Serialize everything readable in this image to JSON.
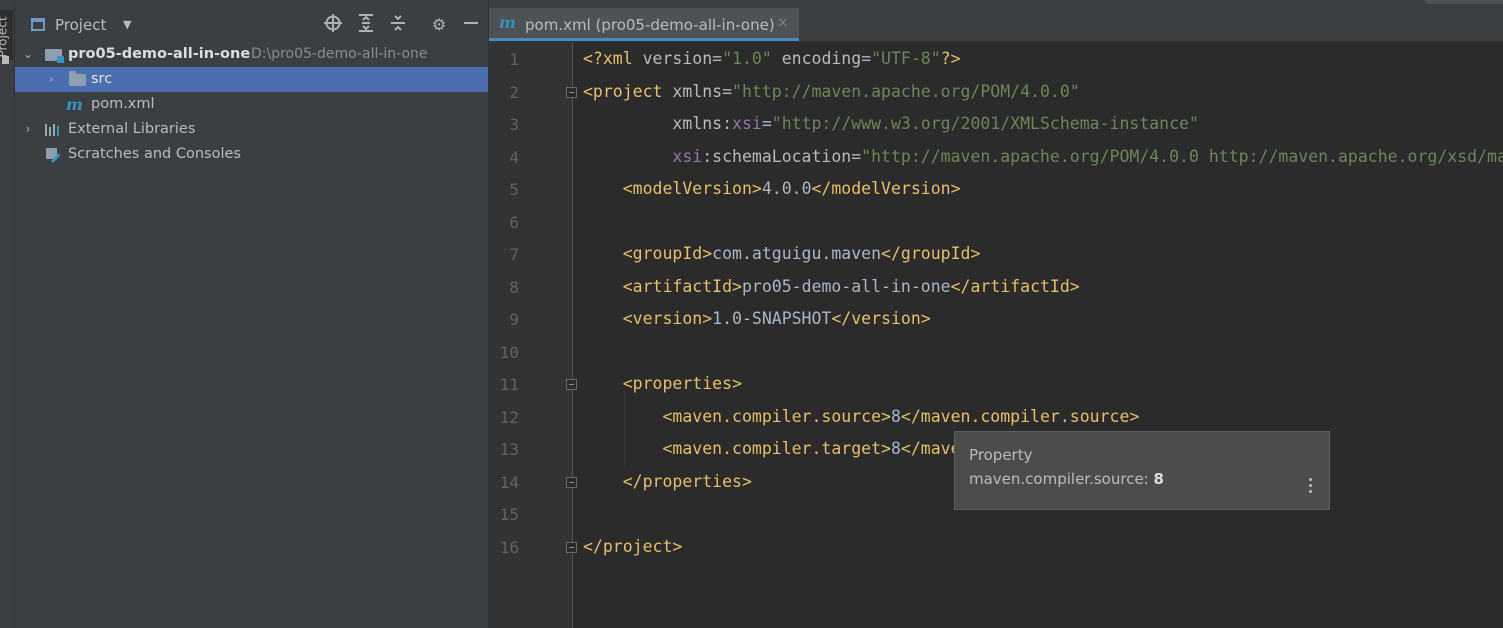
{
  "side_strip": {
    "label": "Project"
  },
  "project_panel": {
    "title": "Project",
    "header_buttons": [
      "locate-icon",
      "expand-all-icon",
      "collapse-all-icon",
      "gear-icon",
      "minimize-icon"
    ],
    "tree": [
      {
        "name": "pro05-demo-all-in-one",
        "path": "D:\\pro05-demo-all-in-one",
        "expanded": true,
        "icon": "module-folder-icon"
      },
      {
        "name": "src",
        "expanded": false,
        "icon": "folder-icon",
        "selected": true
      },
      {
        "name": "pom.xml",
        "icon": "maven-icon"
      },
      {
        "name": "External Libraries",
        "expanded": false,
        "icon": "library-icon"
      },
      {
        "name": "Scratches and Consoles",
        "icon": "scratch-icon"
      }
    ]
  },
  "editor": {
    "tab": {
      "label": "pom.xml (pro05-demo-all-in-one)",
      "close": "×"
    },
    "line_numbers": [
      "1",
      "2",
      "3",
      "4",
      "5",
      "6",
      "7",
      "8",
      "9",
      "10",
      "11",
      "12",
      "13",
      "14",
      "15",
      "16"
    ],
    "tooltip": {
      "title": "Property",
      "key": "maven.compiler.source:",
      "value": "8"
    }
  },
  "colors": {
    "tag": "#e8bf6a",
    "string": "#6a8759",
    "namespace": "#9876aa",
    "selection": "#4b6eaf",
    "accent": "#4a88c7"
  }
}
